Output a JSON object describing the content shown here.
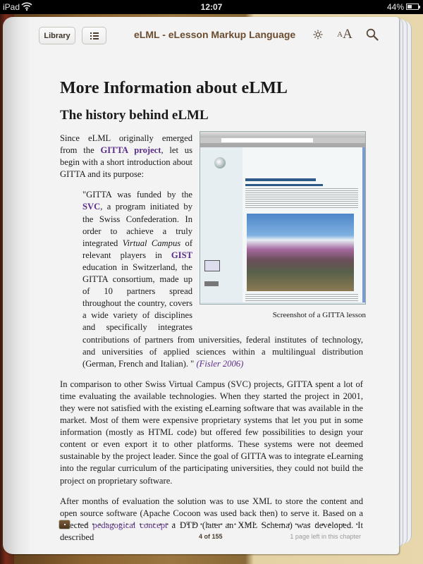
{
  "status_bar": {
    "carrier": "iPad",
    "time": "12:07",
    "battery_percent": "44%",
    "battery_level": 0.44
  },
  "toolbar": {
    "library_label": "Library",
    "toc_icon": "list-icon",
    "book_title": "eLML - eLesson Markup Language",
    "brightness_icon": "sun-icon",
    "fontsize_small": "A",
    "fontsize_big": "A",
    "search_icon": "magnifier-icon"
  },
  "content": {
    "title": "More Information about eLML",
    "subtitle": "The history behind eLML",
    "intro": {
      "before": "Since eLML originally emerged from the ",
      "link": "GITTA project",
      "after": ", let us begin with a short introduction about GITTA and its purpose:"
    },
    "quote": {
      "p1": "\"GITTA was funded by the ",
      "link_svc": "SVC",
      "p2": ", a program initiated by the Swiss Confederation. In order to achieve a truly integrated ",
      "italic": "Virtual Campus",
      "p3": " of relevant players in ",
      "link_gist": "GIST",
      "p4": " education in Switzerland, the GITTA consortium, made up of 10 partners spread throughout the country, covers a wide variety of disciplines and specifically integrates contributions of partners from universities, federal institutes of technology, and universities of applied sciences within a multilingual distribution (German, French and Italian). \" ",
      "citation": "(Fisler 2006)"
    },
    "figure": {
      "caption": "Screenshot of a GITTA lesson"
    },
    "paragraph2": "In comparison to other Swiss Virtual Campus (SVC) projects, GITTA spent a lot of time evaluating the available technologies. When they started the project in 2001, they were not satisfied with the existing eLearning software that was available in the market. Most of them were expensive proprietary systems that let you put in some information (mostly as HTML code) but offered few possibilities to design your content or even export it to other platforms. These systems were not deemed sustainable by the project leader. Since the goal of GITTA was to integrate eLearning into the regular curriculum of the participating universities, they could not build the project on proprietary software.",
    "paragraph3": {
      "before": "After months of evaluation the solution was to use XML to store the content and open source software (Apache Cocoon was used back then) to serve it. Based on a selected ",
      "link": "pedagogical concept",
      "after": " a DTD (later an XML Schema) was developed. It described"
    }
  },
  "footer": {
    "page_indicator": "4 of 155",
    "current_page": 4,
    "total_pages": 155,
    "chapter_remaining": "1 page left in this chapter"
  },
  "colors": {
    "link": "#5a2d88",
    "title_brown": "#6b4c30",
    "page_bg": "#f3f3f3"
  }
}
